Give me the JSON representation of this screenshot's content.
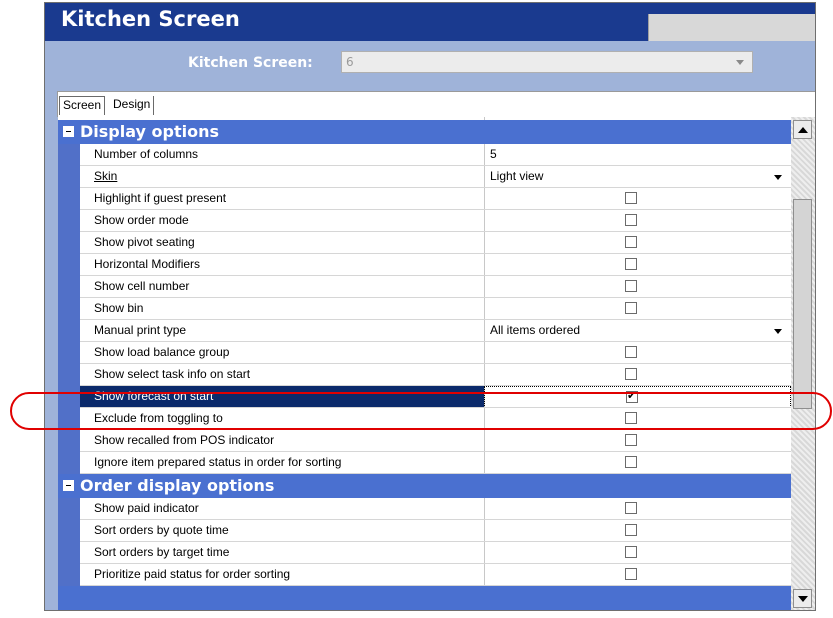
{
  "window": {
    "title": "Kitchen Screen"
  },
  "selector": {
    "label": "Kitchen Screen:",
    "value": "6"
  },
  "tabs": [
    "Screen",
    "Design"
  ],
  "sections": [
    {
      "title": "Display options",
      "rows": [
        {
          "label": "Number of columns",
          "type": "text",
          "value": "5"
        },
        {
          "label": "Skin",
          "type": "dropdown",
          "value": "Light view"
        },
        {
          "label": "Highlight if guest present",
          "type": "checkbox",
          "checked": false
        },
        {
          "label": "Show order mode",
          "type": "checkbox",
          "checked": false
        },
        {
          "label": "Show pivot seating",
          "type": "checkbox",
          "checked": false
        },
        {
          "label": "Horizontal Modifiers",
          "type": "checkbox",
          "checked": false
        },
        {
          "label": "Show cell number",
          "type": "checkbox",
          "checked": false
        },
        {
          "label": "Show bin",
          "type": "checkbox",
          "checked": false
        },
        {
          "label": "Manual print type",
          "type": "dropdown",
          "value": "All items ordered"
        },
        {
          "label": "Show load balance group",
          "type": "checkbox",
          "checked": false
        },
        {
          "label": "Show select task info on start",
          "type": "checkbox",
          "checked": false
        },
        {
          "label": "Show forecast on start",
          "type": "checkbox",
          "checked": true,
          "selected": true
        },
        {
          "label": "Exclude from toggling to",
          "type": "checkbox",
          "checked": false
        },
        {
          "label": "Show recalled from POS indicator",
          "type": "checkbox",
          "checked": false
        },
        {
          "label": "Ignore item prepared status in order for sorting",
          "type": "checkbox",
          "checked": false
        }
      ]
    },
    {
      "title": "Order display options",
      "rows": [
        {
          "label": "Show paid indicator",
          "type": "checkbox",
          "checked": false
        },
        {
          "label": "Sort orders by quote time",
          "type": "checkbox",
          "checked": false
        },
        {
          "label": "Sort orders by target time",
          "type": "checkbox",
          "checked": false
        },
        {
          "label": "Prioritize paid status for order sorting",
          "type": "checkbox",
          "checked": false
        }
      ]
    }
  ],
  "colors": {
    "title_bar": "#1a3a8f",
    "section_header": "#4a70d0",
    "selected_row": "#0b2a6b",
    "highlight": "#e00000"
  }
}
